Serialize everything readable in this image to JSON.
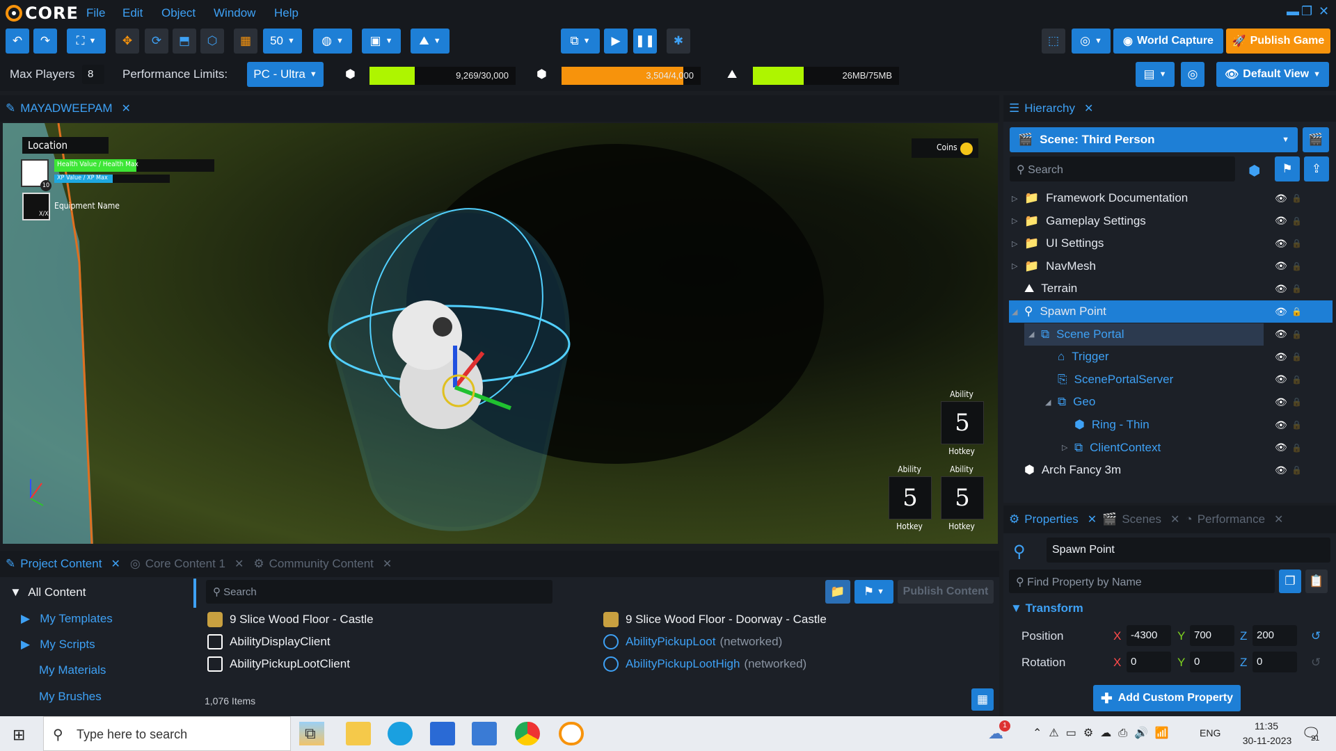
{
  "app": {
    "logo": "CORE"
  },
  "menu": [
    "File",
    "Edit",
    "Object",
    "Window",
    "Help"
  ],
  "toolbar": {
    "snap_value": "50",
    "world_capture": "World Capture",
    "publish_game": "Publish Game",
    "default_view": "Default View"
  },
  "perf": {
    "max_players_label": "Max Players",
    "max_players": "8",
    "limits_label": "Performance Limits:",
    "limits_value": "PC - Ultra",
    "meters": [
      {
        "label": "9,269/30,000",
        "fraction": 0.309,
        "color": "#aef500"
      },
      {
        "label": "3,504/4,000",
        "fraction": 0.876,
        "color": "#f7930c"
      },
      {
        "label": "26MB/75MB",
        "fraction": 0.347,
        "color": "#aef500"
      }
    ]
  },
  "viewport": {
    "tab": "MAYADWEEPAM",
    "hud": {
      "location": "Location",
      "health": "Health Value / Health Max",
      "xp": "XP Value / XP Max",
      "level": "10",
      "equipment": "Equipment Name",
      "equip_count": "X/X",
      "coins": "Coins",
      "abilities": [
        {
          "title": "Ability",
          "key": "5",
          "hotkey": "Hotkey"
        },
        {
          "title": "Ability",
          "key": "5",
          "hotkey": "Hotkey"
        },
        {
          "title": "Ability",
          "key": "5",
          "hotkey": "Hotkey"
        }
      ]
    }
  },
  "hierarchy": {
    "tab": "Hierarchy",
    "scene": "Scene: Third Person",
    "search_placeholder": "Search",
    "items": [
      "Framework Documentation",
      "Gameplay Settings",
      "UI Settings",
      "NavMesh",
      "Terrain",
      "Spawn Point",
      "Scene Portal",
      "Trigger",
      "ScenePortalServer",
      "Geo",
      "Ring - Thin",
      "ClientContext",
      "Arch Fancy 3m"
    ]
  },
  "properties": {
    "tabs": [
      "Properties",
      "Scenes",
      "Performance"
    ],
    "name": "Spawn Point",
    "find_placeholder": "Find Property by Name",
    "section": "Transform",
    "position_label": "Position",
    "position": {
      "x": "-4300",
      "y": "700",
      "z": "200"
    },
    "rotation_label": "Rotation",
    "rotation": {
      "x": "0",
      "y": "0",
      "z": "0"
    },
    "add_custom": "Add Custom Property"
  },
  "content": {
    "tabs": [
      "Project Content",
      "Core Content 1",
      "Community Content"
    ],
    "all": "All Content",
    "tree": [
      "My Templates",
      "My Scripts",
      "My Materials",
      "My Brushes"
    ],
    "search_placeholder": "Search",
    "publish": "Publish Content",
    "count": "1,076 Items",
    "left": [
      "9 Slice Wood Floor - Castle",
      "AbilityDisplayClient",
      "AbilityPickupLootClient"
    ],
    "right": [
      {
        "name": "9 Slice Wood Floor - Doorway - Castle",
        "net": ""
      },
      {
        "name": "AbilityPickupLoot",
        "net": "(networked)"
      },
      {
        "name": "AbilityPickupLootHigh",
        "net": "(networked)"
      }
    ]
  },
  "taskbar": {
    "search_placeholder": "Type here to search",
    "lang": "ENG",
    "time": "11:35",
    "date": "30-11-2023",
    "notif_count": "21",
    "weather_badge": "1"
  },
  "colors": {
    "accent": "#1e7fd6",
    "link": "#3ea1f5",
    "publish": "#f7930c"
  }
}
